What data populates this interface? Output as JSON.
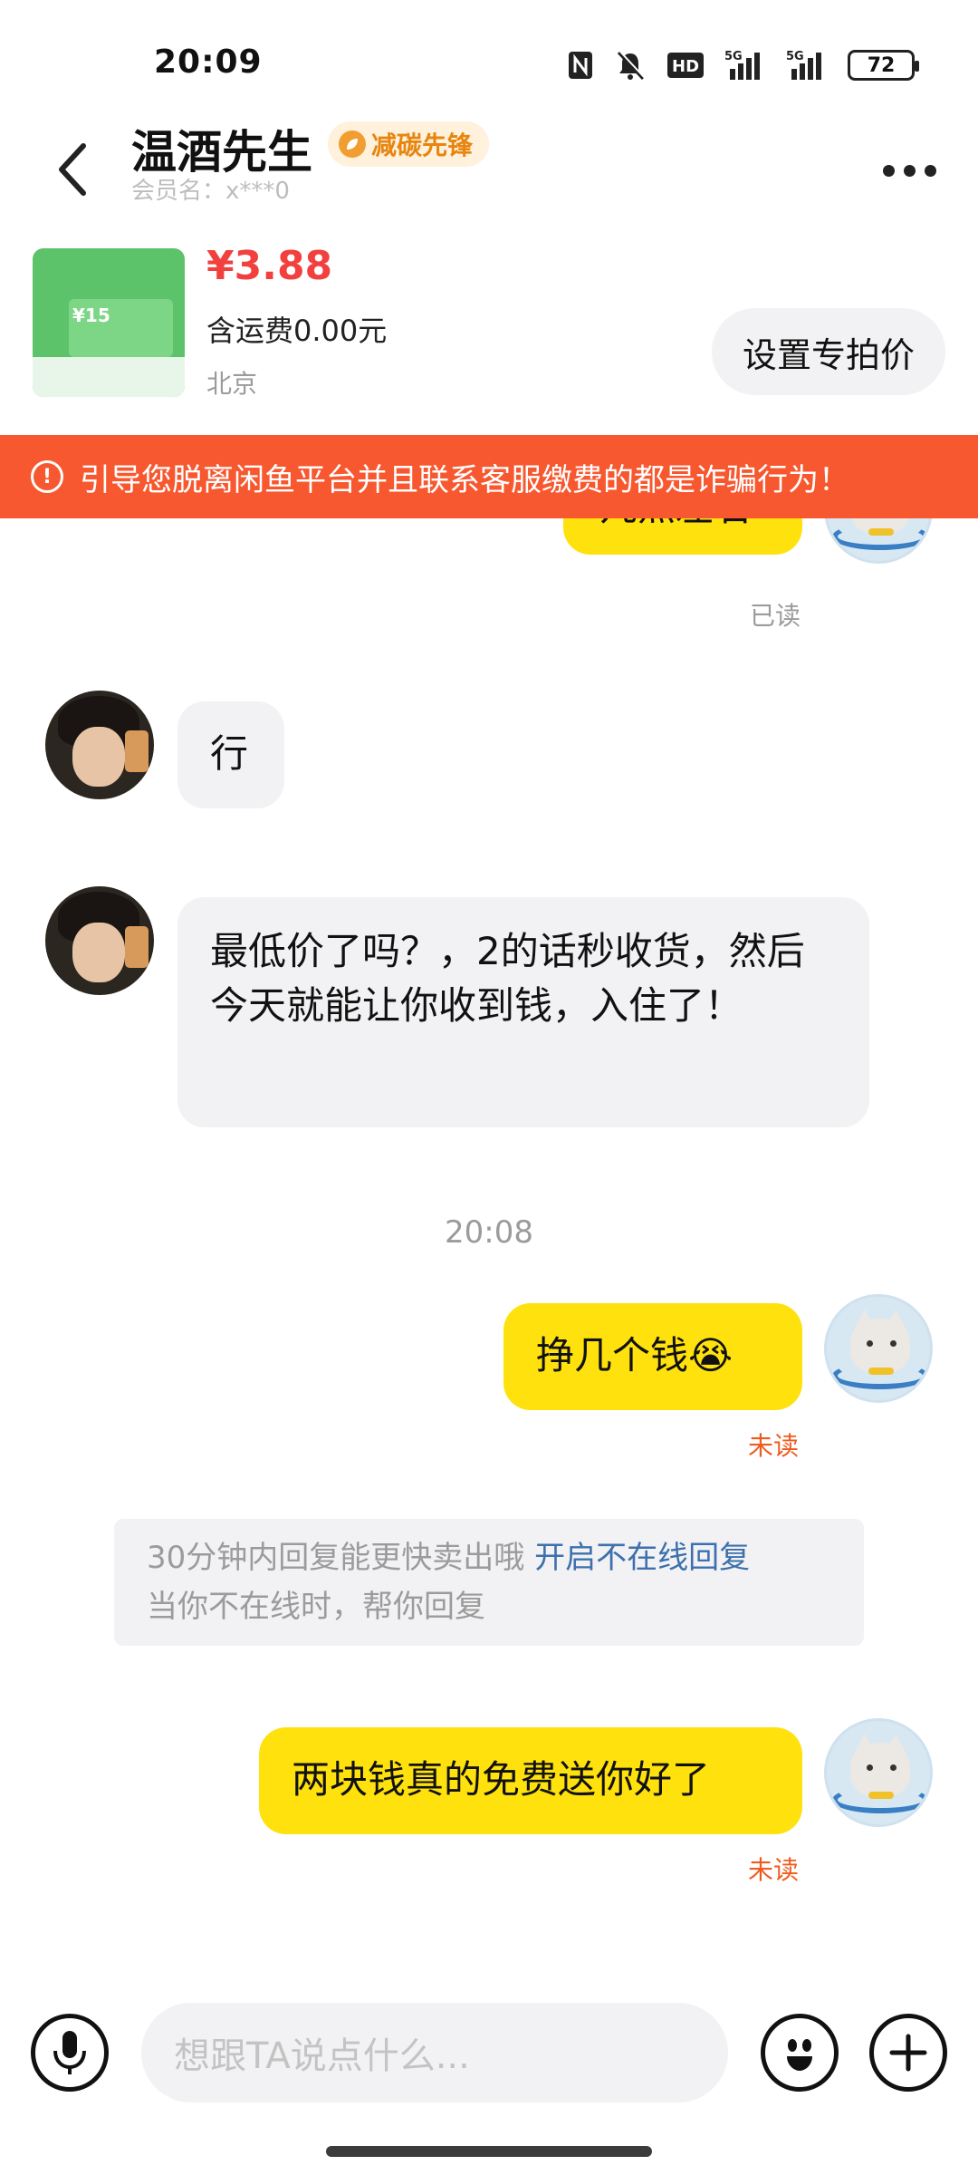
{
  "status_bar": {
    "time": "20:09",
    "battery": "72",
    "icons": [
      "nfc-icon",
      "mute-icon",
      "hd-icon",
      "5g-signal-icon",
      "5g-signal-icon",
      "battery-icon"
    ],
    "hd_label": "HD",
    "net1": "5G",
    "net2": "5G"
  },
  "header": {
    "title": "温酒先生",
    "badge": "减碳先锋",
    "member": "会员名：x***0"
  },
  "product": {
    "price": "¥3.88",
    "shipping": "含运费0.00元",
    "location": "北京",
    "set_price_button": "设置专拍价",
    "thumb_value": "¥15"
  },
  "warning": {
    "text": "引导您脱离闲鱼平台并且联系客服缴费的都是诈骗行为！"
  },
  "messages": {
    "m1_text": "几点左右",
    "m1_status": "已读",
    "m2_text": "行",
    "m3_text": "最低价了吗？，2的话秒收货，然后今天就能让你收到钱，入住了！",
    "time_divider": "20:08",
    "m4_text": "挣几个钱😭",
    "m4_status": "未读",
    "system_line1": "30分钟内回复能更快卖出哦",
    "system_link": "开启不在线回复",
    "system_line2": "当你不在线时，帮你回复",
    "m5_text": "两块钱真的免费送你好了",
    "m5_status": "未读"
  },
  "input": {
    "placeholder": "想跟TA说点什么..."
  },
  "colors": {
    "my_bubble": "#ffe10e",
    "their_bubble": "#f2f2f4",
    "warning_bg": "#f7582f",
    "price": "#f2403f",
    "unread": "#f05a1e",
    "link": "#3e70ad"
  }
}
